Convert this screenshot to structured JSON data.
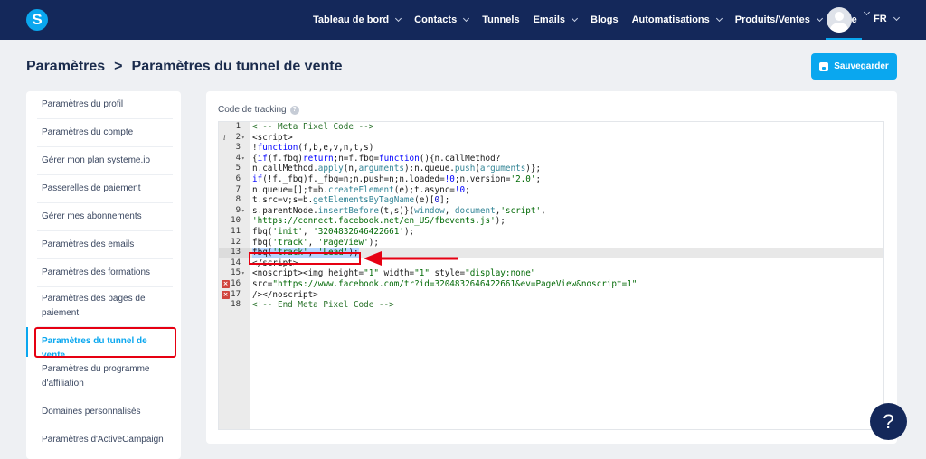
{
  "nav": {
    "logo": "S",
    "items": [
      {
        "label": "Tableau de bord",
        "chevron": true
      },
      {
        "label": "Contacts",
        "chevron": true
      },
      {
        "label": "Tunnels",
        "chevron": false
      },
      {
        "label": "Emails",
        "chevron": true
      },
      {
        "label": "Blogs",
        "chevron": false
      },
      {
        "label": "Automatisations",
        "chevron": true
      },
      {
        "label": "Produits/Ventes",
        "chevron": true
      },
      {
        "label": "Aide",
        "chevron": false
      }
    ],
    "language": "FR"
  },
  "header": {
    "breadcrumb_root": "Paramètres",
    "separator": ">",
    "current": "Paramètres du tunnel de vente",
    "save_label": "Sauvegarder"
  },
  "sidebar": {
    "items": [
      {
        "label": "Paramètres du profil"
      },
      {
        "label": "Paramètres du compte"
      },
      {
        "label": "Gérer mon plan systeme.io"
      },
      {
        "label": "Passerelles de paiement"
      },
      {
        "label": "Gérer mes abonnements"
      },
      {
        "label": "Paramètres des emails"
      },
      {
        "label": "Paramètres des formations"
      },
      {
        "label": "Paramètres des pages de paiement"
      },
      {
        "label": "Paramètres du tunnel de vente",
        "active": true
      },
      {
        "label": "Paramètres du programme d'affiliation"
      },
      {
        "label": "Domaines personnalisés"
      },
      {
        "label": "Paramètres d'ActiveCampaign"
      }
    ]
  },
  "editor": {
    "label": "Code de tracking",
    "help": "?",
    "lines": [
      {
        "n": "1",
        "html": "<span class=\"c-com\">&lt;!-- Meta Pixel Code --&gt;</span>"
      },
      {
        "n": "2",
        "fold": true,
        "info": true,
        "html": "<span class=\"c-tag\">&lt;script&gt;</span>"
      },
      {
        "n": "3",
        "html": "!<span class=\"c-kw\">function</span>(f,b,e,v,n,t,s)"
      },
      {
        "n": "4",
        "fold": true,
        "html": "{<span class=\"c-kw\">if</span>(f.fbq)<span class=\"c-kw\">return</span>;n=f.fbq=<span class=\"c-kw\">function</span>(){n.callMethod?"
      },
      {
        "n": "5",
        "html": "n.callMethod.<span class=\"c-bi\">apply</span>(n,<span class=\"c-bi\">arguments</span>):n.queue.<span class=\"c-bi\">push</span>(<span class=\"c-bi\">arguments</span>)};"
      },
      {
        "n": "6",
        "html": "<span class=\"c-kw\">if</span>(!f._fbq)f._fbq=n;n.push=n;n.loaded=<span class=\"c-kw\">!0</span>;n.version=<span class=\"c-str\">'2.0'</span>;"
      },
      {
        "n": "7",
        "html": "n.queue=[];t=b.<span class=\"c-bi\">createElement</span>(e);t.async=<span class=\"c-kw\">!0</span>;"
      },
      {
        "n": "8",
        "html": "t.src=v;s=b.<span class=\"c-bi\">getElementsByTagName</span>(e)[<span class=\"c-num\">0</span>];"
      },
      {
        "n": "9",
        "fold": true,
        "html": "s.parentNode.<span class=\"c-bi\">insertBefore</span>(t,s)}(<span class=\"c-bi\">window</span>, <span class=\"c-bi\">document</span>,<span class=\"c-str\">'script'</span>,"
      },
      {
        "n": "10",
        "html": "<span class=\"c-str\">'https://connect.facebook.net/en_US/fbevents.js'</span>);"
      },
      {
        "n": "11",
        "html": "fbq(<span class=\"c-str\">'init'</span>, <span class=\"c-str\">'3204832646422661'</span>);"
      },
      {
        "n": "12",
        "html": "fbq(<span class=\"c-str\">'track'</span>, <span class=\"c-str\">'PageView'</span>);"
      },
      {
        "n": "13",
        "active": true,
        "html": "<span class=\"sel\">fbq(<span class=\"c-str\">'track'</span>, <span class=\"c-str\">'Lead'</span>);</span>"
      },
      {
        "n": "14",
        "html": "<span class=\"c-tag\">&lt;/script&gt;</span>"
      },
      {
        "n": "15",
        "fold": true,
        "html": "<span class=\"c-tag\">&lt;noscript&gt;&lt;img</span> height=<span class=\"c-str\">\"1\"</span> width=<span class=\"c-str\">\"1\"</span> style=<span class=\"c-str\">\"display:none\"</span>"
      },
      {
        "n": "16",
        "error": true,
        "html": "src=<span class=\"c-str\">\"https://www.facebook.com/tr?id=3204832646422661&amp;ev=PageView&amp;noscript=1\"</span>"
      },
      {
        "n": "17",
        "error": true,
        "html": "/&gt;<span class=\"c-tag\">&lt;/noscript&gt;</span>"
      },
      {
        "n": "18",
        "html": "<span class=\"c-com\">&lt;!-- End Meta Pixel Code --&gt;</span>"
      }
    ]
  },
  "help_button": "?",
  "colors": {
    "nav_bg": "#14285a",
    "accent": "#0aa7ef",
    "annotation": "#e60012"
  }
}
